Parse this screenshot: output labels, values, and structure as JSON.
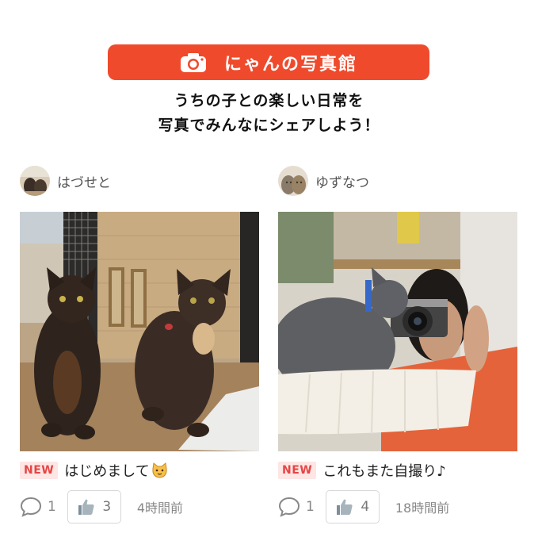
{
  "banner": {
    "title": "にゃんの写真館",
    "icon": "camera-icon",
    "color": "#f04a2d"
  },
  "tagline": {
    "line1": "うちの子との楽しい日常を",
    "line2": "写真でみんなにシェアしよう！"
  },
  "posts": [
    {
      "username": "はづせと",
      "badge": "NEW",
      "title": "はじめまして",
      "title_emoji": "cat-face-emoji",
      "comments": "1",
      "likes": "3",
      "time": "4時間前"
    },
    {
      "username": "ゆずなつ",
      "badge": "NEW",
      "title": "これもまた自撮り♪",
      "comments": "1",
      "likes": "4",
      "time": "18時間前"
    }
  ],
  "icons": {
    "comment": "comment-icon",
    "like": "thumbs-up-icon"
  },
  "colors": {
    "badge_bg": "#fde6e4",
    "badge_text": "#e64545"
  }
}
